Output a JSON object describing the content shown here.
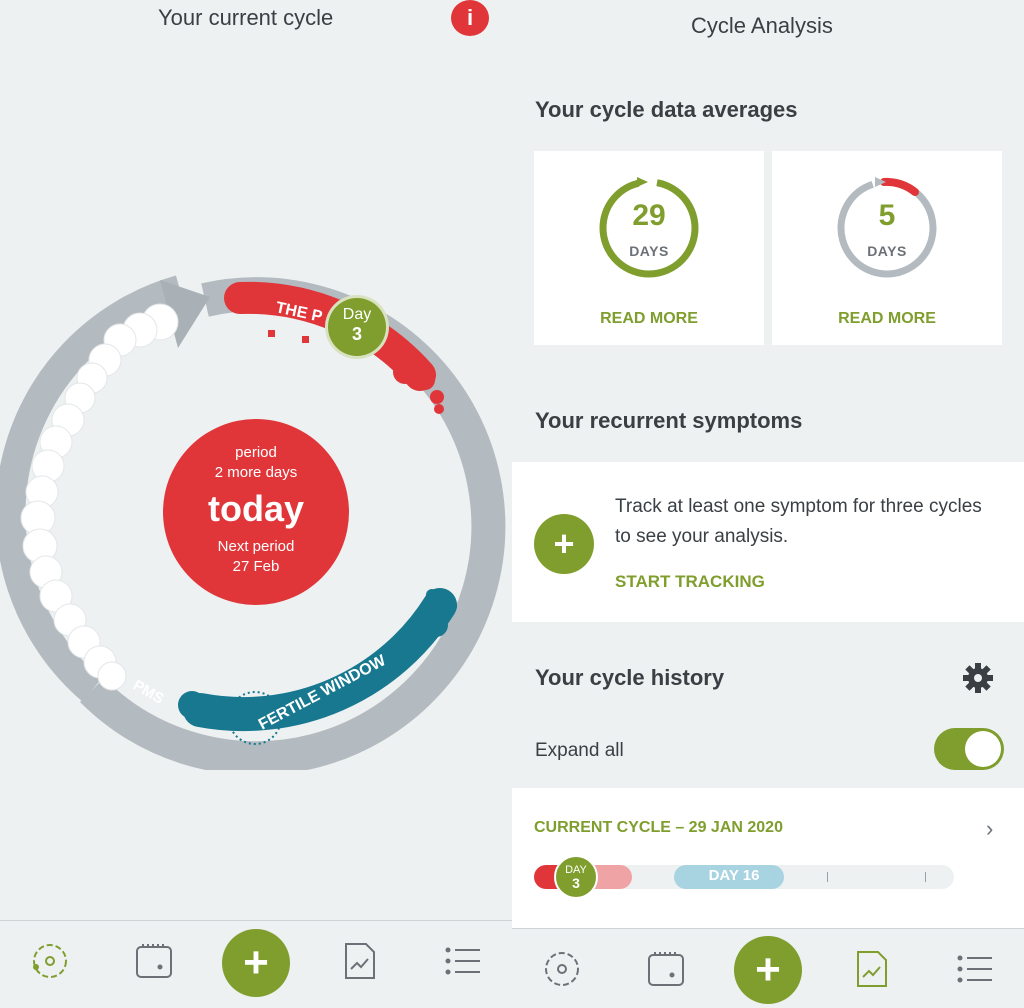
{
  "left": {
    "title": "Your current cycle",
    "info_icon": "i",
    "wheel": {
      "period_label": "THE P",
      "pms_label": "PMS",
      "fertile_label": "FERTILE WINDOW"
    },
    "day_badge": {
      "label": "Day",
      "number": "3"
    },
    "center": {
      "line1": "period",
      "line2": "2 more days",
      "big": "today",
      "line3": "Next period",
      "line4": "27 Feb"
    },
    "nav": {
      "plus": "+"
    }
  },
  "right": {
    "title": "Cycle Analysis",
    "averages_title": "Your cycle data averages",
    "avg_cards": [
      {
        "number": "29",
        "unit": "DAYS",
        "link": "READ MORE"
      },
      {
        "number": "5",
        "unit": "DAYS",
        "link": "READ MORE"
      }
    ],
    "symptoms_title": "Your recurrent symptoms",
    "symptoms_text": "Track at least one symptom for three cycles to see your analysis.",
    "symptoms_plus": "+",
    "symptoms_link": "START TRACKING",
    "history_title": "Your cycle history",
    "expand_label": "Expand all",
    "current_cycle": "CURRENT CYCLE – 29 JAN 2020",
    "timeline_day_badge": {
      "label": "DAY",
      "number": "3"
    },
    "timeline_day16": "DAY 16",
    "nav": {
      "plus": "+"
    }
  },
  "colors": {
    "red": "#e0363a",
    "green": "#7f9e2d",
    "teal": "#17788f",
    "grey": "#b4bbc0"
  }
}
